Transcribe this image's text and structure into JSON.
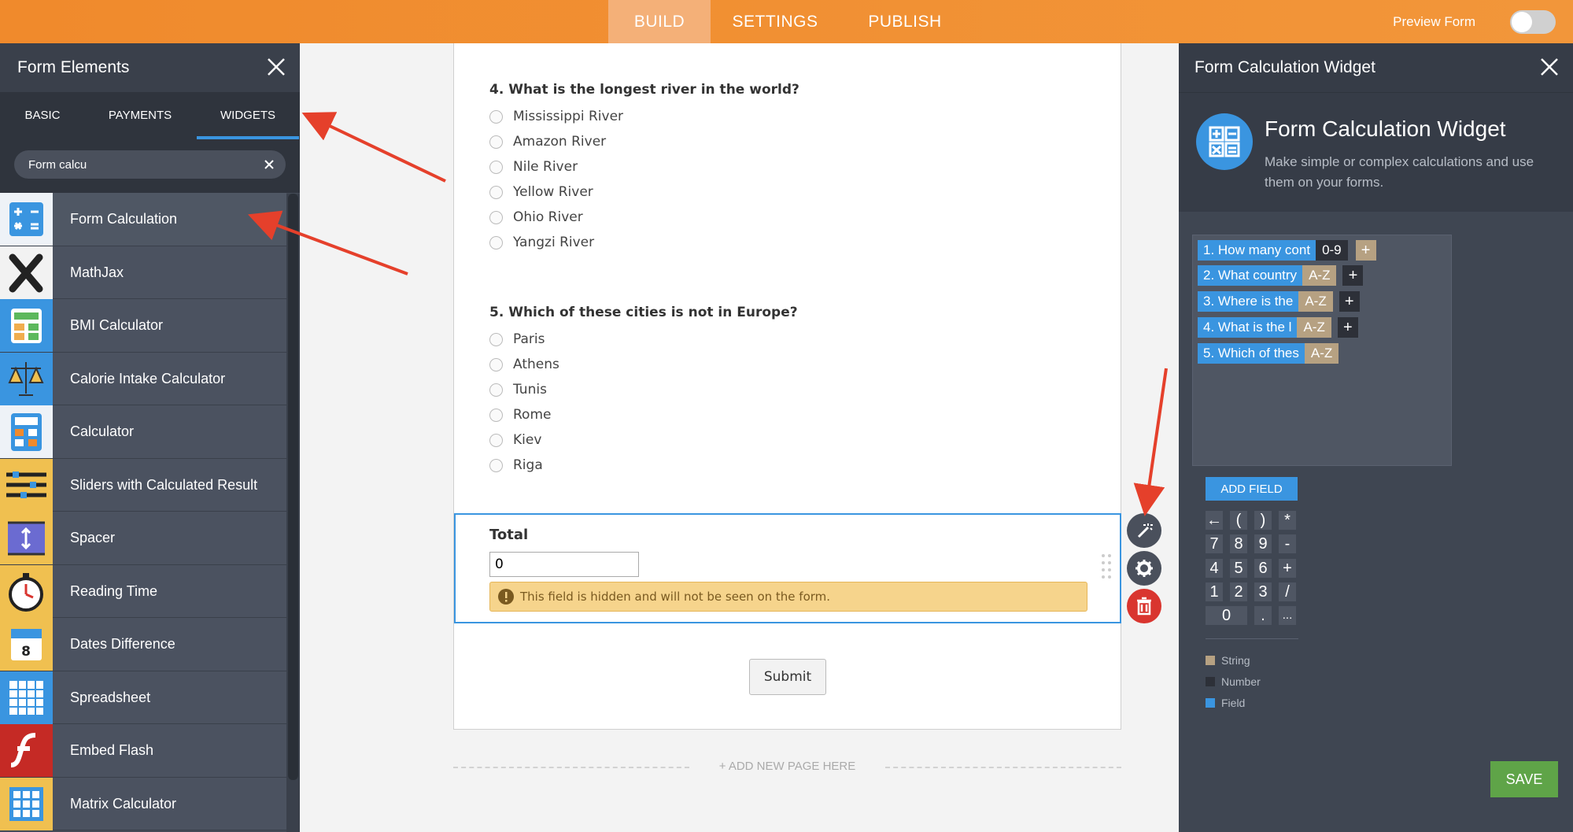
{
  "topbar": {
    "tabs": [
      "BUILD",
      "SETTINGS",
      "PUBLISH"
    ],
    "preview_label": "Preview Form"
  },
  "left_panel": {
    "title": "Form Elements",
    "tabs": [
      "BASIC",
      "PAYMENTS",
      "WIDGETS"
    ],
    "active_tab": "WIDGETS",
    "search_value": "Form calcu",
    "widgets": [
      {
        "label": "Form Calculation",
        "icon": "calculator-grid-icon"
      },
      {
        "label": "MathJax",
        "icon": "mathjax-icon"
      },
      {
        "label": "BMI Calculator",
        "icon": "bmi-calculator-icon"
      },
      {
        "label": "Calorie Intake Calculator",
        "icon": "scales-icon"
      },
      {
        "label": "Calculator",
        "icon": "calculator-icon"
      },
      {
        "label": "Sliders with Calculated Result",
        "icon": "sliders-icon"
      },
      {
        "label": "Spacer",
        "icon": "spacer-icon"
      },
      {
        "label": "Reading Time",
        "icon": "stopwatch-icon"
      },
      {
        "label": "Dates Difference",
        "icon": "calendar-icon"
      },
      {
        "label": "Spreadsheet",
        "icon": "spreadsheet-icon"
      },
      {
        "label": "Embed Flash",
        "icon": "flash-icon"
      },
      {
        "label": "Matrix Calculator",
        "icon": "matrix-icon"
      }
    ]
  },
  "form": {
    "q4": {
      "title": "4. What is the longest river in the world?",
      "options": [
        "Mississippi River",
        "Amazon River",
        "Nile River",
        "Yellow River",
        "Ohio River",
        "Yangzi River"
      ]
    },
    "q5": {
      "title": "5. Which of these cities is not in Europe?",
      "options": [
        "Paris",
        "Athens",
        "Tunis",
        "Rome",
        "Kiev",
        "Riga"
      ]
    },
    "total": {
      "label": "Total",
      "value": "0",
      "notice": "This field is hidden and will not be seen on the form."
    },
    "submit_label": "Submit",
    "add_page_label": "+ ADD NEW PAGE HERE"
  },
  "right_panel": {
    "header_title": "Form Calculation Widget",
    "widget_title": "Form Calculation Widget",
    "widget_desc": "Make simple or complex calculations and use them on your forms.",
    "fields": [
      {
        "field": "1. How many cont",
        "type": "0-9"
      },
      {
        "field": "2. What country",
        "type": "A-Z"
      },
      {
        "field": "3. Where is the",
        "type": "A-Z"
      },
      {
        "field": "4. What is the l",
        "type": "A-Z"
      },
      {
        "field": "5. Which of thes",
        "type": "A-Z"
      }
    ],
    "add_field_label": "ADD FIELD",
    "keypad": [
      [
        "←",
        "(",
        ")",
        "*"
      ],
      [
        "7",
        "8",
        "9",
        "-"
      ],
      [
        "4",
        "5",
        "6",
        "+"
      ],
      [
        "1",
        "2",
        "3",
        "/"
      ],
      [
        "0",
        ".",
        "..."
      ]
    ],
    "legend": [
      "String",
      "Number",
      "Field"
    ],
    "save_label": "SAVE"
  },
  "colors": {
    "topbar": "#f08a2c",
    "field_tag": "#3a95e0",
    "string_tag": "#b6a182",
    "save": "#5fa448",
    "delete": "#d9352f",
    "annotation_arrow": "#e5402b"
  }
}
